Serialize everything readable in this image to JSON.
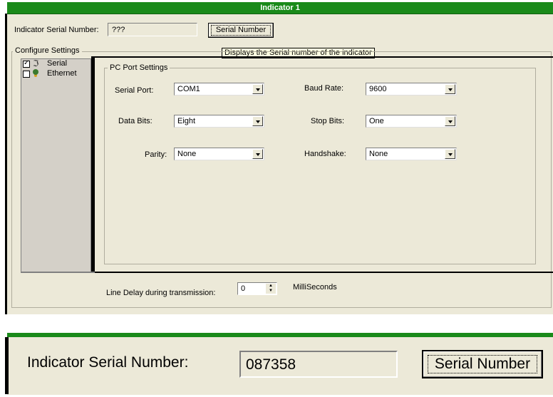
{
  "window": {
    "title": "Indicator 1"
  },
  "serial": {
    "label": "Indicator Serial Number:",
    "value": "???",
    "button": "Serial Number"
  },
  "tooltip": "Displays the Serial number of the indicator",
  "configure": {
    "label": "Configure Settings"
  },
  "tree": [
    {
      "label": "Serial",
      "checked": true,
      "icon": "serial-cable-icon"
    },
    {
      "label": "Ethernet",
      "checked": false,
      "icon": "network-icon"
    }
  ],
  "pc_port": {
    "title": "PC Port Settings",
    "fields": [
      {
        "label": "Serial Port:",
        "value": "COM1"
      },
      {
        "label": "Baud Rate:",
        "value": "9600"
      },
      {
        "label": "Data Bits:",
        "value": "Eight"
      },
      {
        "label": "Stop Bits:",
        "value": "One"
      },
      {
        "label": "Parity:",
        "value": "None"
      },
      {
        "label": "Handshake:",
        "value": "None"
      }
    ]
  },
  "line_delay": {
    "label": "Line Delay during transmission:",
    "value": "0",
    "unit": "MilliSeconds"
  },
  "zoom": {
    "label": "Indicator Serial Number:",
    "value": "087358",
    "button": "Serial Number"
  },
  "colors": {
    "title_bar": "#1a8a1a",
    "panel": "#ece9d8",
    "tree_bg": "#d4d0c8"
  }
}
